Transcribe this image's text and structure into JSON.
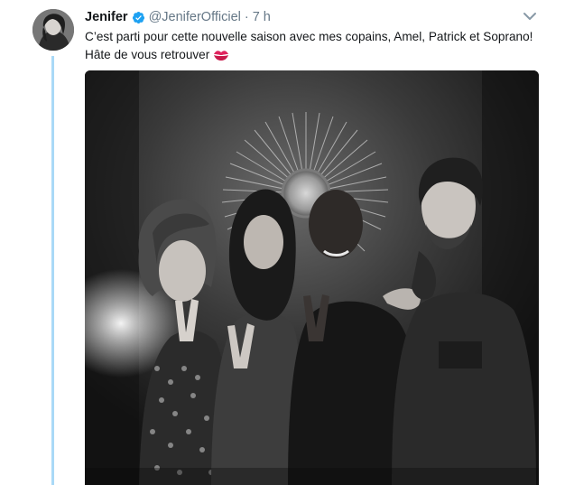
{
  "tweet": {
    "display_name": "Jenifer",
    "verified": true,
    "handle": "@JeniferOfficiel",
    "separator": "·",
    "time": "7 h",
    "text_line1": "C’est parti pour cette nouvelle saison avec mes copains, Amel, Patrick et Soprano!",
    "text_line2": "Hâte de vous retrouver",
    "emoji": "kiss-mark-icon"
  },
  "colors": {
    "thread_line": "#a9d9f7",
    "verified_badge": "#1da1f2",
    "handle_text": "#657786",
    "body_text": "#14171a",
    "emoji": "#e0245e"
  },
  "icons": {
    "verified": "verified-badge-icon",
    "caret": "chevron-down-icon",
    "emoji": "kiss-mark-icon"
  }
}
